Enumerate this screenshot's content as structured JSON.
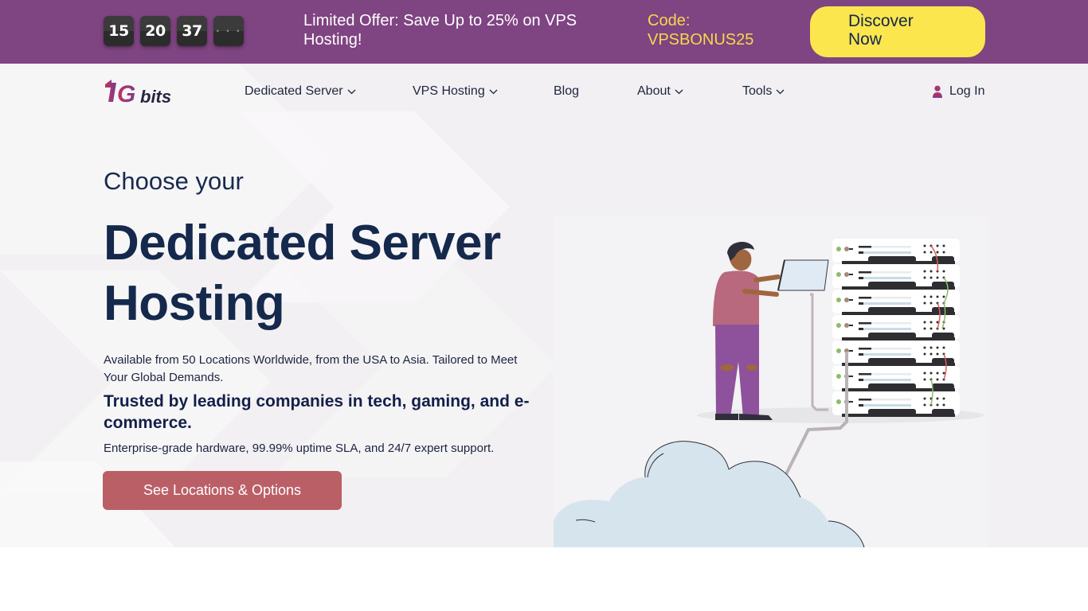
{
  "promo": {
    "countdown": [
      "15",
      "20",
      "37",
      "· · ·"
    ],
    "message": "Limited Offer: Save Up to 25% on VPS Hosting!",
    "code_label": "Code:",
    "code": "VPSBONUS25",
    "cta_label": "Discover Now",
    "colors": {
      "background": "#7f4482",
      "code": "#f7d84a",
      "button": "#fbe64e"
    }
  },
  "header": {
    "logo_text": "1Gbits",
    "nav": [
      {
        "label": "Dedicated Server",
        "dropdown": true
      },
      {
        "label": "VPS Hosting",
        "dropdown": true
      },
      {
        "label": "Blog",
        "dropdown": false
      },
      {
        "label": "About",
        "dropdown": true
      },
      {
        "label": "Tools",
        "dropdown": true
      }
    ],
    "login_label": "Log In"
  },
  "hero": {
    "eyebrow": "Choose your",
    "title": "Dedicated Server Hosting",
    "description": "Available from 50 Locations Worldwide, from the USA to Asia. Tailored to Meet Your Global Demands.",
    "trust_line": "Trusted by leading companies in tech, gaming, and e-commerce.",
    "features_line": "Enterprise-grade hardware, 99.99% uptime SLA, and 24/7 expert support.",
    "cta_label": "See Locations & Options",
    "cta_color": "#bb5f67",
    "illustration": "person-with-laptop-server-rack-cloud"
  }
}
